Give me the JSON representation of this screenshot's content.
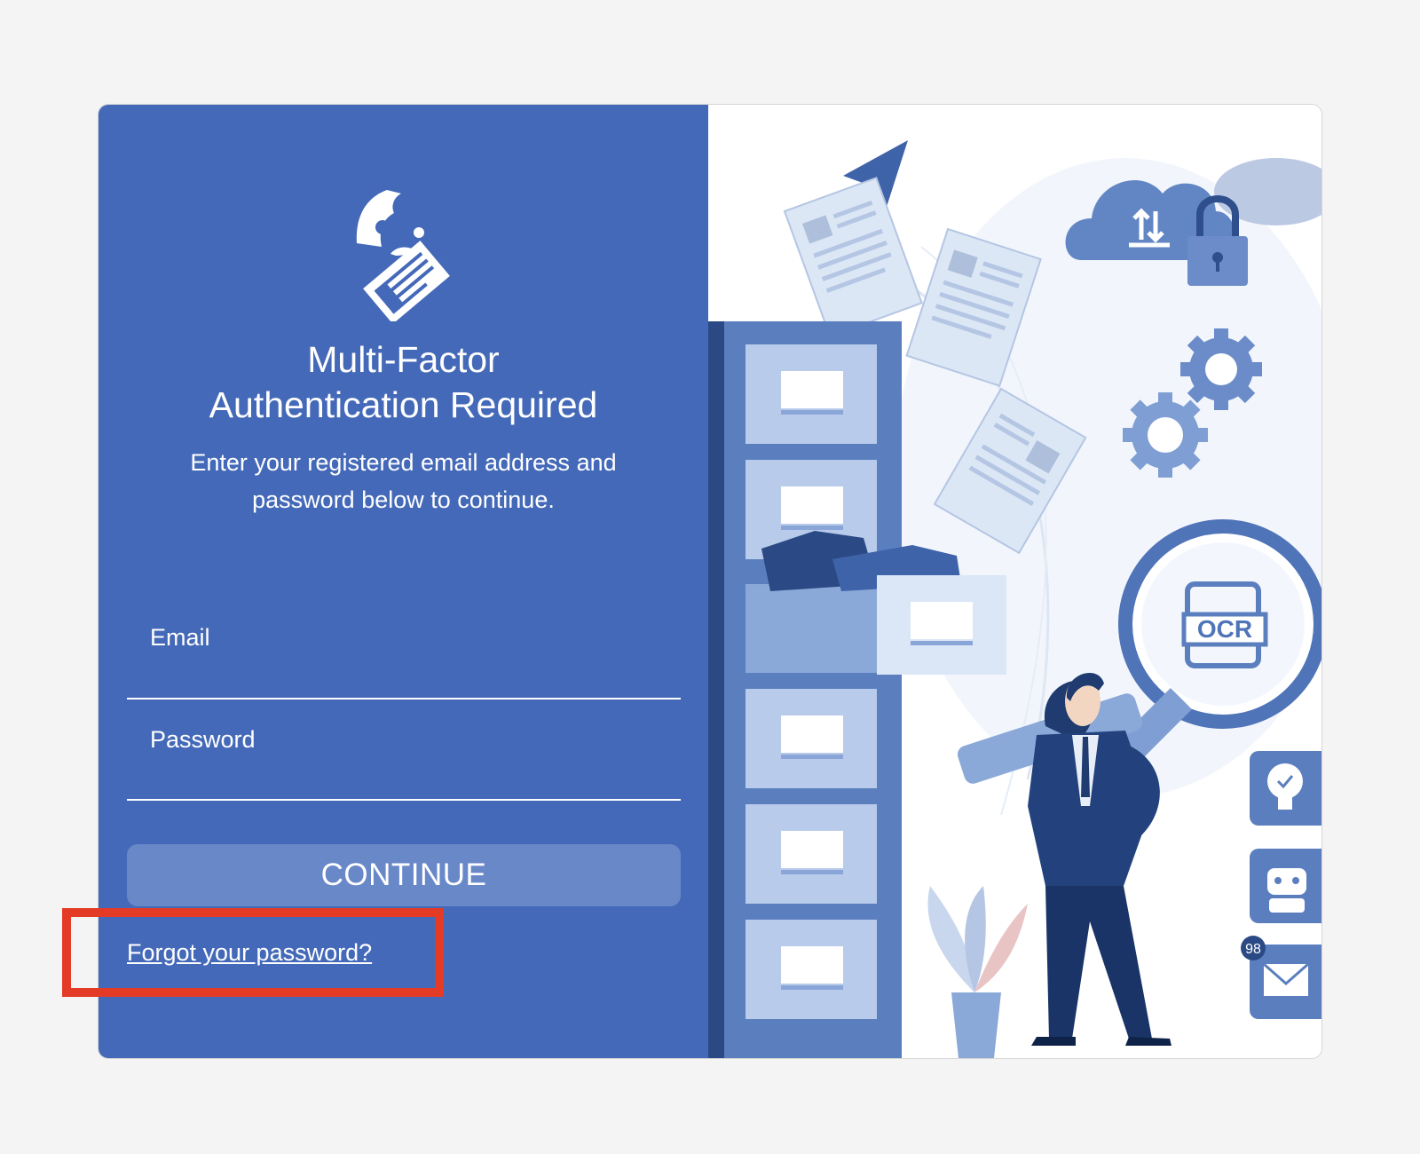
{
  "form": {
    "title_line1": "Multi-Factor",
    "title_line2": "Authentication Required",
    "subtitle": "Enter your registered email address and password below to continue.",
    "email_label": "Email",
    "email_value": "",
    "password_label": "Password",
    "password_value": "",
    "continue_label": "CONTINUE",
    "forgot_label": "Forgot your password?"
  },
  "illustration": {
    "ocr_label": "OCR",
    "mail_badge": "98"
  },
  "colors": {
    "panel": "#4469b8",
    "button": "#6988c8",
    "highlight": "#e43b26"
  }
}
